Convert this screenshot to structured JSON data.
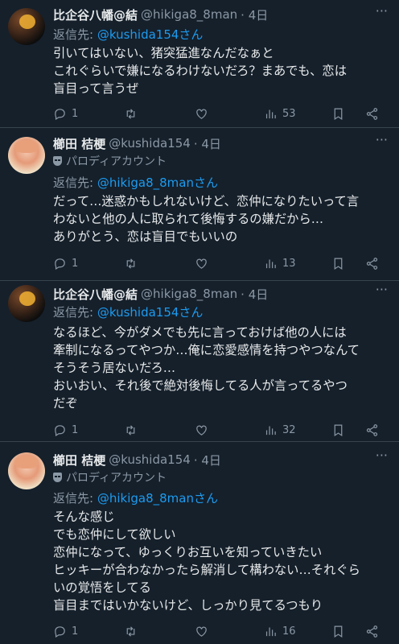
{
  "tweets": [
    {
      "name": "比企谷八幡@結",
      "handle": "@hikiga8_8man",
      "time": "· 4日",
      "parody": "",
      "reply_prefix": "返信先:",
      "reply_mention": "@kushida154さん",
      "lines": [
        "引いてはいない、猪突猛進なんだなぁと",
        "これぐらいで嫌になるわけないだろ？まあでも、恋は",
        "盲目って言うぜ"
      ],
      "reply_count": "1",
      "retweet_count": "",
      "like_count": "",
      "view_count": "53"
    },
    {
      "name": "櫛田 桔梗",
      "handle": "@kushida154",
      "time": "· 4日",
      "parody": "パロディアカウント",
      "reply_prefix": "返信先:",
      "reply_mention": "@hikiga8_8manさん",
      "lines": [
        "だって…迷惑かもしれないけど、恋仲になりたいって言",
        "わないと他の人に取られて後悔するの嫌だから…",
        "ありがとう、恋は盲目でもいいの"
      ],
      "reply_count": "1",
      "retweet_count": "",
      "like_count": "",
      "view_count": "13"
    },
    {
      "name": "比企谷八幡@結",
      "handle": "@hikiga8_8man",
      "time": "· 4日",
      "parody": "",
      "reply_prefix": "返信先:",
      "reply_mention": "@kushida154さん",
      "lines": [
        "なるほど、今がダメでも先に言っておけば他の人には",
        "牽制になるってやつか…俺に恋愛感情を持つやつなんて",
        "そうそう居ないだろ…",
        "おいおい、それ後で絶対後悔してる人が言ってるやつ",
        "だぞ"
      ],
      "reply_count": "1",
      "retweet_count": "",
      "like_count": "",
      "view_count": "32"
    },
    {
      "name": "櫛田 桔梗",
      "handle": "@kushida154",
      "time": "· 4日",
      "parody": "パロディアカウント",
      "reply_prefix": "返信先:",
      "reply_mention": "@hikiga8_8manさん",
      "lines": [
        "そんな感じ",
        "でも恋仲にして欲しい",
        "恋仲になって、ゆっくりお互いを知っていきたい",
        "ヒッキーが合わなかったら解消して構わない…それぐら",
        "いの覚悟をしてる",
        "盲目まではいかないけど、しっかり見てるつもり"
      ],
      "reply_count": "1",
      "retweet_count": "",
      "like_count": "",
      "view_count": "16"
    }
  ],
  "more_glyph": "···",
  "colors": {
    "background": "#15202b",
    "text": "#e7e9ea",
    "muted": "#8b98a5",
    "link": "#1d9bf0",
    "divider": "#38444d"
  }
}
